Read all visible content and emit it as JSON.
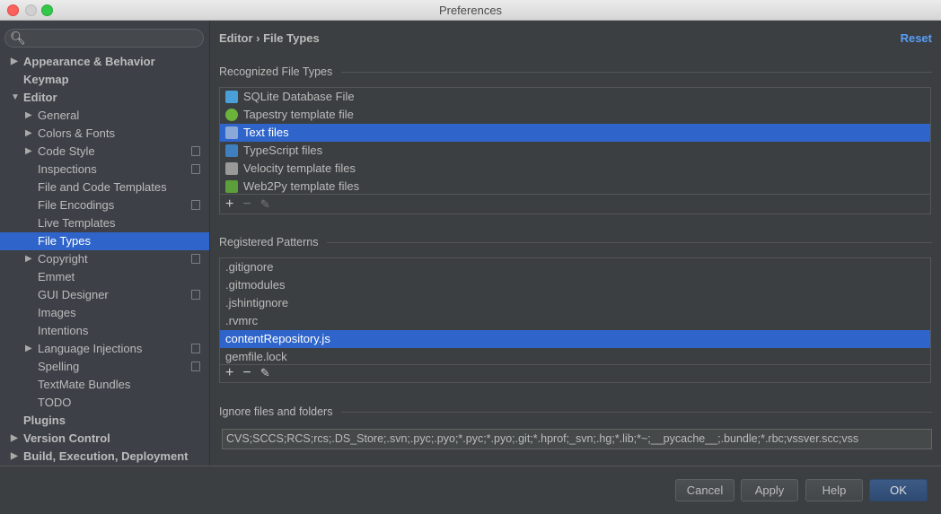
{
  "window": {
    "title": "Preferences"
  },
  "sidebar": {
    "search_placeholder": "",
    "items": [
      {
        "label": "Appearance & Behavior",
        "level": 0,
        "bold": true,
        "arrow": "right"
      },
      {
        "label": "Keymap",
        "level": 0,
        "bold": true
      },
      {
        "label": "Editor",
        "level": 0,
        "bold": true,
        "arrow": "down"
      },
      {
        "label": "General",
        "level": 1,
        "arrow": "right"
      },
      {
        "label": "Colors & Fonts",
        "level": 1,
        "arrow": "right"
      },
      {
        "label": "Code Style",
        "level": 1,
        "arrow": "right",
        "project": true
      },
      {
        "label": "Inspections",
        "level": 1,
        "project": true
      },
      {
        "label": "File and Code Templates",
        "level": 1
      },
      {
        "label": "File Encodings",
        "level": 1,
        "project": true
      },
      {
        "label": "Live Templates",
        "level": 1
      },
      {
        "label": "File Types",
        "level": 1,
        "selected": true
      },
      {
        "label": "Copyright",
        "level": 1,
        "arrow": "right",
        "project": true
      },
      {
        "label": "Emmet",
        "level": 1
      },
      {
        "label": "GUI Designer",
        "level": 1,
        "project": true
      },
      {
        "label": "Images",
        "level": 1
      },
      {
        "label": "Intentions",
        "level": 1
      },
      {
        "label": "Language Injections",
        "level": 1,
        "arrow": "right",
        "project": true
      },
      {
        "label": "Spelling",
        "level": 1,
        "project": true
      },
      {
        "label": "TextMate Bundles",
        "level": 1
      },
      {
        "label": "TODO",
        "level": 1
      },
      {
        "label": "Plugins",
        "level": 0,
        "bold": true
      },
      {
        "label": "Version Control",
        "level": 0,
        "bold": true,
        "arrow": "right"
      },
      {
        "label": "Build, Execution, Deployment",
        "level": 0,
        "bold": true,
        "arrow": "right"
      }
    ]
  },
  "main": {
    "breadcrumb": "Editor › File Types",
    "reset_label": "Reset",
    "recognized": {
      "title": "Recognized File Types",
      "items": [
        {
          "label": "SQLite Database File",
          "icon": "database-icon",
          "color": "#4a9fd8"
        },
        {
          "label": "Tapestry template file",
          "icon": "tapestry-icon",
          "color": "#6bb33a"
        },
        {
          "label": "Text files",
          "icon": "text-file-icon",
          "color": "#8aa8d8",
          "selected": true
        },
        {
          "label": "TypeScript files",
          "icon": "typescript-icon",
          "color": "#3f7fbf"
        },
        {
          "label": "Velocity template files",
          "icon": "velocity-icon",
          "color": "#999999"
        },
        {
          "label": "Web2Py template files",
          "icon": "web2py-icon",
          "color": "#5c9e3a"
        }
      ]
    },
    "patterns": {
      "title": "Registered Patterns",
      "items": [
        {
          "label": ".gitignore"
        },
        {
          "label": ".gitmodules"
        },
        {
          "label": ".jshintignore"
        },
        {
          "label": ".rvmrc"
        },
        {
          "label": "contentRepository.js",
          "selected": true
        },
        {
          "label": "gemfile.lock"
        }
      ]
    },
    "toolbar": {
      "add": "+",
      "remove": "−",
      "edit": "✎"
    },
    "ignore": {
      "title": "Ignore files and folders",
      "value": "CVS;SCCS;RCS;rcs;.DS_Store;.svn;.pyc;.pyo;*.pyc;*.pyo;.git;*.hprof;_svn;.hg;*.lib;*~;__pycache__;.bundle;*.rbc;vssver.scc;vss"
    }
  },
  "buttons": {
    "cancel": "Cancel",
    "apply": "Apply",
    "help": "Help",
    "ok": "OK"
  },
  "colors": {
    "selection": "#2f65ca",
    "link": "#589df6"
  }
}
